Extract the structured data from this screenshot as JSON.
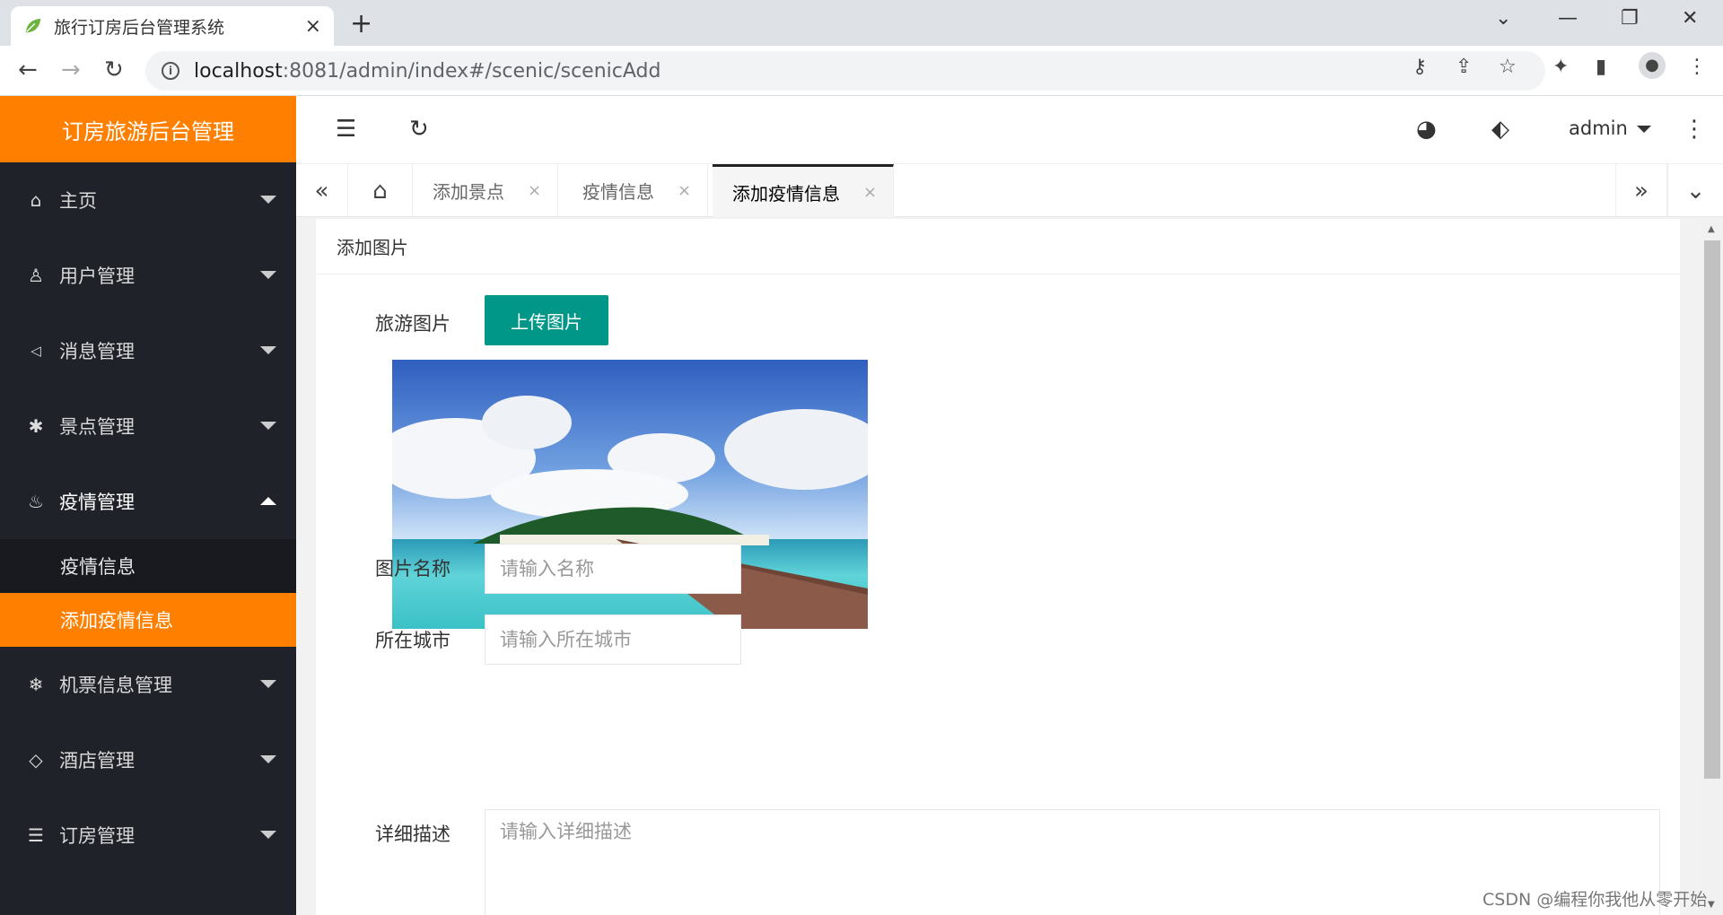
{
  "browser": {
    "tab_title": "旅行订房后台管理系统",
    "tab_close": "×",
    "new_tab": "+",
    "url_host": "localhost",
    "url_rest": ":8081/admin/index#/scenic/scenicAdd"
  },
  "sidebar": {
    "logo": "订房旅游后台管理",
    "items": [
      {
        "label": "主页",
        "icon": "home-icon"
      },
      {
        "label": "用户管理",
        "icon": "user-icon"
      },
      {
        "label": "消息管理",
        "icon": "speaker-icon"
      },
      {
        "label": "景点管理",
        "icon": "palm-icon"
      },
      {
        "label": "疫情管理",
        "icon": "fire-icon"
      },
      {
        "label": "机票信息管理",
        "icon": "snowflake-icon"
      },
      {
        "label": "酒店管理",
        "icon": "diamond-icon"
      },
      {
        "label": "订房管理",
        "icon": "list-icon"
      }
    ],
    "sub_items": [
      {
        "label": "疫情信息"
      },
      {
        "label": "添加疫情信息"
      }
    ]
  },
  "header": {
    "user": "admin"
  },
  "page_tabs": [
    {
      "label": "添加景点"
    },
    {
      "label": "疫情信息"
    },
    {
      "label": "添加疫情信息"
    }
  ],
  "content": {
    "card_title": "添加图片",
    "image_label": "旅游图片",
    "upload_button": "上传图片",
    "name_label": "图片名称",
    "name_placeholder": "请输入名称",
    "city_label": "所在城市",
    "city_placeholder": "请输入所在城市",
    "desc_label": "详细描述",
    "desc_placeholder": "请输入详细描述"
  },
  "watermark": "CSDN @编程你我他从零开始",
  "colors": {
    "accent": "#ff8000",
    "sidebar_bg": "#20222a",
    "button_green": "#009688"
  }
}
